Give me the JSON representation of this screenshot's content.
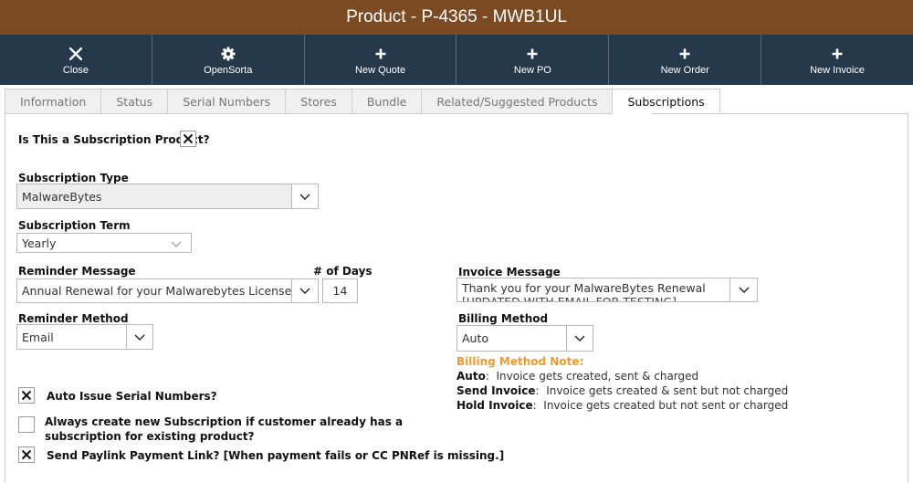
{
  "window": {
    "title": "Product - P-4365 - MWB1UL"
  },
  "toolbar": {
    "buttons": [
      {
        "label": "Close",
        "icon": "close-icon"
      },
      {
        "label": "OpenSorta",
        "icon": "gear-icon"
      },
      {
        "label": "New Quote",
        "icon": "plus-icon"
      },
      {
        "label": "New PO",
        "icon": "plus-icon"
      },
      {
        "label": "New Order",
        "icon": "plus-icon"
      },
      {
        "label": "New Invoice",
        "icon": "plus-icon"
      }
    ]
  },
  "tabs": [
    "Information",
    "Status",
    "Serial Numbers",
    "Stores",
    "Bundle",
    "Related/Suggested Products",
    "Subscriptions"
  ],
  "active_tab": "Subscriptions",
  "form": {
    "is_subscription_label": "Is This a Subscription Product?",
    "is_subscription_checked": true,
    "subscription_type": {
      "label": "Subscription Type",
      "value": "MalwareBytes"
    },
    "subscription_term": {
      "label": "Subscription Term",
      "value": "Yearly"
    },
    "reminder_message": {
      "label": "Reminder Message",
      "value": "Annual Renewal for your Malwarebytes License!"
    },
    "days": {
      "label": "# of Days",
      "value": "14"
    },
    "invoice_message": {
      "label": "Invoice Message",
      "value": "Thank you for your MalwareBytes Renewal",
      "value_line2": "[UPDATED WITH EMAIL FOR TESTING]"
    },
    "reminder_method": {
      "label": "Reminder Method",
      "value": "Email"
    },
    "billing_method": {
      "label": "Billing Method",
      "value": "Auto"
    },
    "billing_note": {
      "title": "Billing Method Note:",
      "lines": [
        {
          "key": "Auto",
          "text": "Invoice gets created, sent & charged"
        },
        {
          "key": "Send Invoice",
          "text": "Invoice gets created & sent but not charged"
        },
        {
          "key": "Hold Invoice",
          "text": "Invoice gets created but not sent or charged"
        }
      ]
    },
    "auto_issue": {
      "label": "Auto Issue Serial Numbers?",
      "checked": true
    },
    "always_create": {
      "label_line1": "Always create new Subscription if customer already has a",
      "label_line2": "subscription for existing product?",
      "checked": false
    },
    "send_paylink": {
      "label": "Send Paylink Payment Link? [When payment fails or CC PNRef is missing.]",
      "checked": true
    }
  },
  "colors": {
    "title_bar": "#7b4a22",
    "toolbar": "#26394a",
    "note_accent": "#f39a2b"
  }
}
